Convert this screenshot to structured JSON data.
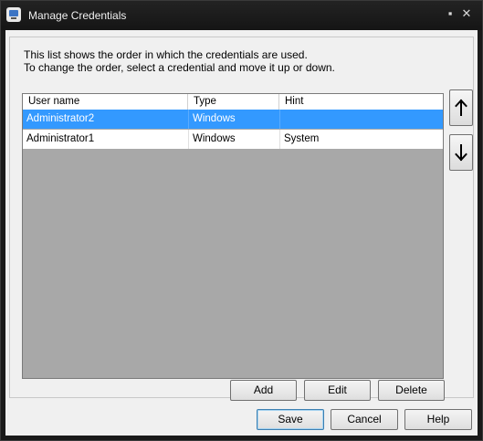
{
  "window": {
    "title": "Manage Credentials",
    "maximize_glyph": "▪",
    "close_glyph": "✕"
  },
  "description": {
    "line1": "This list shows the order in which the credentials are used.",
    "line2": "To change the order, select a credential and move it up or down."
  },
  "list": {
    "columns": [
      "User name",
      "Type",
      "Hint"
    ],
    "rows": [
      {
        "user": "Administrator2",
        "type": "Windows",
        "hint": "",
        "selected": true
      },
      {
        "user": "Administrator1",
        "type": "Windows",
        "hint": "System",
        "selected": false
      }
    ]
  },
  "reorder": {
    "up_icon": "arrow-up-icon",
    "down_icon": "arrow-down-icon"
  },
  "list_actions": {
    "add": "Add",
    "edit": "Edit",
    "delete": "Delete"
  },
  "dialog_buttons": {
    "save": "Save",
    "cancel": "Cancel",
    "help": "Help"
  },
  "colors": {
    "selection": "#3399ff",
    "list_background": "#a8a8a8",
    "title_bar": "#1a1a1a"
  }
}
